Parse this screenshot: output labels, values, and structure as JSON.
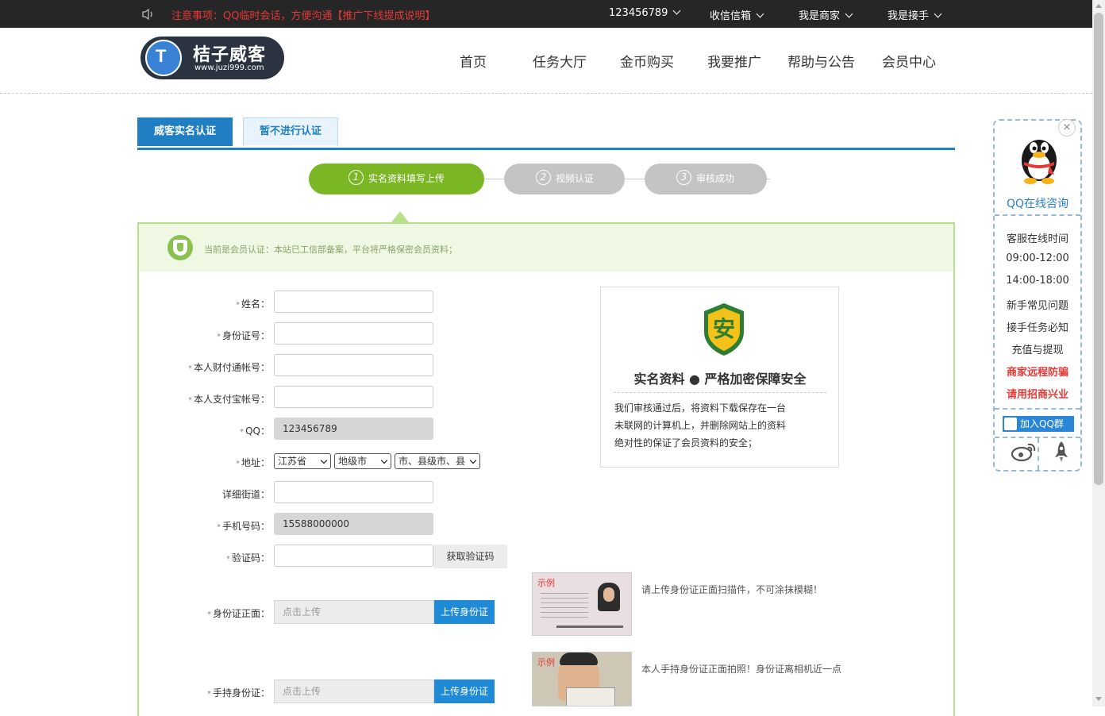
{
  "topbar": {
    "notice": "注意事项：QQ临时会话，方便沟通【推广下线提成说明】",
    "nav": [
      {
        "label": "123456789"
      },
      {
        "label": "收信信箱"
      },
      {
        "label": "我是商家"
      },
      {
        "label": "我是接手"
      }
    ]
  },
  "logo": {
    "name": "桔子威客",
    "url": "www.juzi999.com",
    "mark": "T"
  },
  "mainnav": [
    "首页",
    "任务大厅",
    "金币购买",
    "我要推广",
    "帮助与公告",
    "会员中心"
  ],
  "tabs": {
    "active": "威客实名认证",
    "other": "暂不进行认证"
  },
  "steps": [
    {
      "num": "1",
      "label": "实名资料填写上传"
    },
    {
      "num": "2",
      "label": "视频认证"
    },
    {
      "num": "3",
      "label": "审核成功"
    }
  ],
  "banner": {
    "note": "当前是会员认证：本站已工信部备案，平台将严格保密会员资料；"
  },
  "form": {
    "required_mark": "*",
    "name_label": "姓名：",
    "idno_label": "身份证号：",
    "tenpay_label": "本人财付通帐号：",
    "alipay_label": "本人支付宝帐号：",
    "qq_label": "QQ：",
    "qq_value": "123456789",
    "address_label": "地址：",
    "province": "江苏省",
    "city": "地级市",
    "county": "市、县级市、县",
    "street_label": "详细街道：",
    "phone_label": "手机号码：",
    "phone_value": "15588000000",
    "code_label": "验证码：",
    "code_button": "获取验证码",
    "idfront_label": "身份证正面：",
    "idhand_label": "手持身份证：",
    "upload_placeholder": "点击上传",
    "upload_button": "上传身份证"
  },
  "security": {
    "title": "实名资料 ● 严格加密保障安全",
    "lines": [
      "我们审核通过后，将资料下载保存在一台",
      "未联网的计算机上，并删除网站上的资料",
      "绝对性的保证了会员资料的安全；"
    ],
    "badge_text": "安"
  },
  "samples": {
    "tag": "示例",
    "front_text": "请上传身份证正面扫描件，不可涂抹模糊！",
    "hand_text": "本人手持身份证正面拍照！身份证离相机近一点"
  },
  "side": {
    "qq_text": "QQ在线咨询",
    "items": [
      "客服在线时间",
      "09:00-12:00",
      "14:00-18:00",
      "新手常见问题",
      "接手任务必知",
      "充值与提现"
    ],
    "red_items": [
      "商家远程防骗",
      "请用招商兴业"
    ],
    "join": "加入QQ群",
    "close": "×"
  }
}
